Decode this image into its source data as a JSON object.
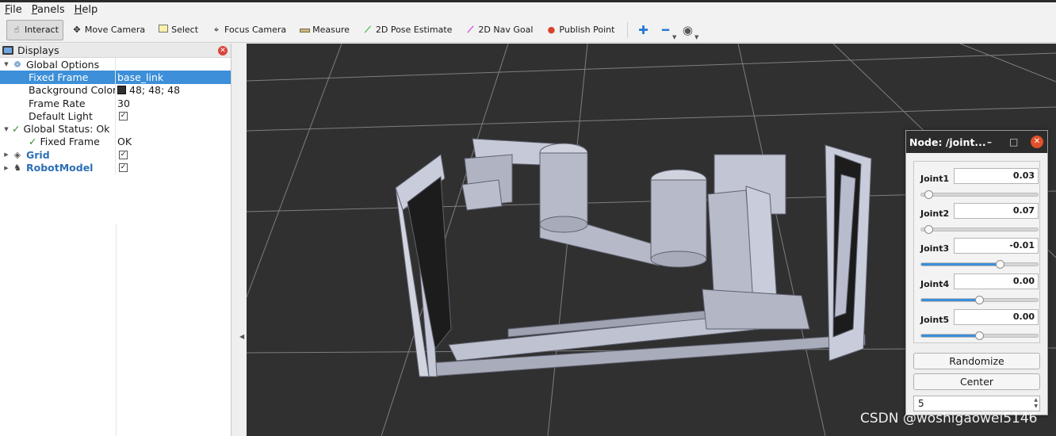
{
  "menu": [
    {
      "label": "File",
      "u": "F",
      "rest": "ile"
    },
    {
      "label": "Panels",
      "u": "P",
      "rest": "anels"
    },
    {
      "label": "Help",
      "u": "H",
      "rest": "elp"
    }
  ],
  "toolbar": {
    "interact": "Interact",
    "move_camera": "Move Camera",
    "select": "Select",
    "focus_camera": "Focus Camera",
    "measure": "Measure",
    "pose_estimate": "2D Pose Estimate",
    "nav_goal": "2D Nav Goal",
    "publish_point": "Publish Point"
  },
  "displays": {
    "title": "Displays",
    "rows": {
      "global_options": "Global Options",
      "fixed_frame": {
        "label": "Fixed Frame",
        "value": "base_link"
      },
      "background_color": {
        "label": "Background Color",
        "value": "48; 48; 48",
        "color": "#303030"
      },
      "frame_rate": {
        "label": "Frame Rate",
        "value": "30"
      },
      "default_light": {
        "label": "Default Light",
        "checked": true
      },
      "global_status": "Global Status: Ok",
      "status_fixed_frame": {
        "label": "Fixed Frame",
        "value": "OK"
      },
      "grid": {
        "label": "Grid",
        "checked": true
      },
      "robot_model": {
        "label": "RobotModel",
        "checked": true
      }
    }
  },
  "node_window": {
    "title": "Node: /joint...",
    "joints": [
      {
        "label": "Joint1",
        "value": "0.03",
        "position": 0.03
      },
      {
        "label": "Joint2",
        "value": "0.07",
        "position": 0.03
      },
      {
        "label": "Joint3",
        "value": "-0.01",
        "position": 0.68
      },
      {
        "label": "Joint4",
        "value": "0.00",
        "position": 0.49
      },
      {
        "label": "Joint5",
        "value": "0.00",
        "position": 0.49
      }
    ],
    "randomize": "Randomize",
    "center": "Center",
    "spin_value": "5"
  },
  "watermark": "CSDN @woshigaowei5146",
  "colors": {
    "viewport_bg": "#303030",
    "selection": "#3c8fd8",
    "model": "#b9bccc"
  }
}
